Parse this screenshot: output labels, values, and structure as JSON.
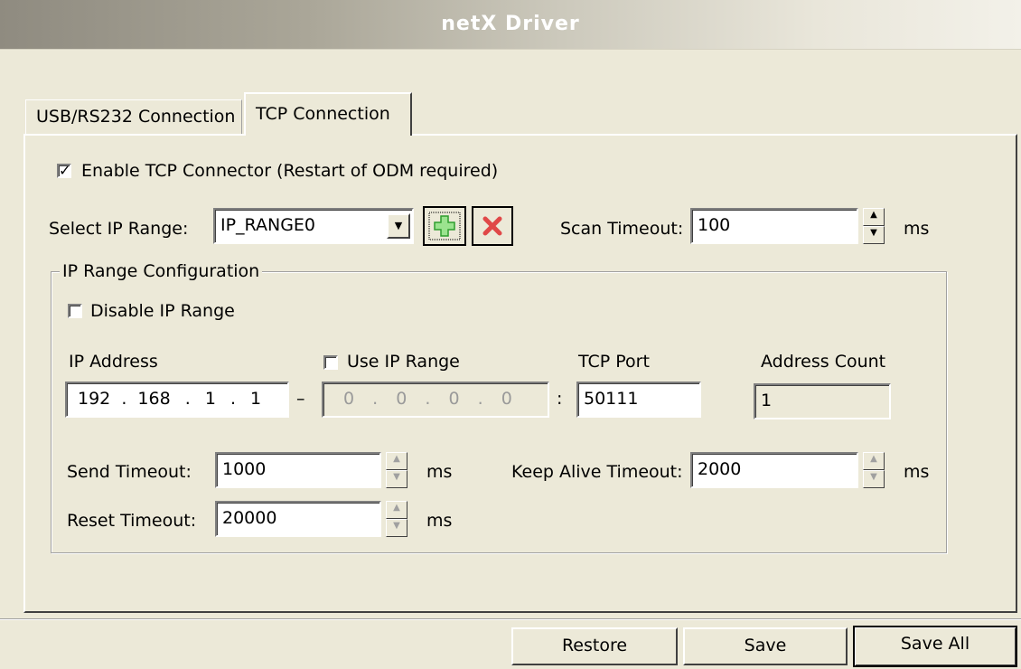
{
  "window": {
    "title": "netX Driver"
  },
  "tabs": [
    {
      "label": "USB/RS232 Connection"
    },
    {
      "label": "TCP Connection"
    }
  ],
  "tcp": {
    "enable_label": "Enable TCP Connector (Restart of ODM required)",
    "enable_checked": true,
    "select_ip_range_label": "Select IP Range:",
    "ip_range_selected": "IP_RANGE0",
    "add_icon": "plus-icon",
    "delete_icon": "x-icon",
    "scan_timeout_label": "Scan Timeout:",
    "scan_timeout_value": "100",
    "scan_timeout_unit": "ms"
  },
  "config": {
    "group_title": "IP Range Configuration",
    "disable_label": "Disable IP Range",
    "ip_address_label": "IP Address",
    "use_ip_range_label": "Use IP Range",
    "tcp_port_label": "TCP Port",
    "address_count_label": "Address Count",
    "ip_octets": [
      "192",
      "168",
      "1",
      "1"
    ],
    "range_separator": "–",
    "ip_end_octets": [
      "0",
      "0",
      "0",
      "0"
    ],
    "port_separator": ":",
    "tcp_port_value": "50111",
    "address_count_value": "1",
    "send_timeout_label": "Send Timeout:",
    "send_timeout_value": "1000",
    "keep_alive_label": "Keep Alive Timeout:",
    "keep_alive_value": "2000",
    "reset_timeout_label": "Reset Timeout:",
    "reset_timeout_value": "20000",
    "unit": "ms",
    "ip_dot": "."
  },
  "footer": {
    "restore_label": "Restore",
    "save_label": "Save",
    "save_all_label": "Save All"
  },
  "colors": {
    "background": "#ece9d8",
    "add_icon": "#3fb83f",
    "delete_icon": "#e04848"
  }
}
